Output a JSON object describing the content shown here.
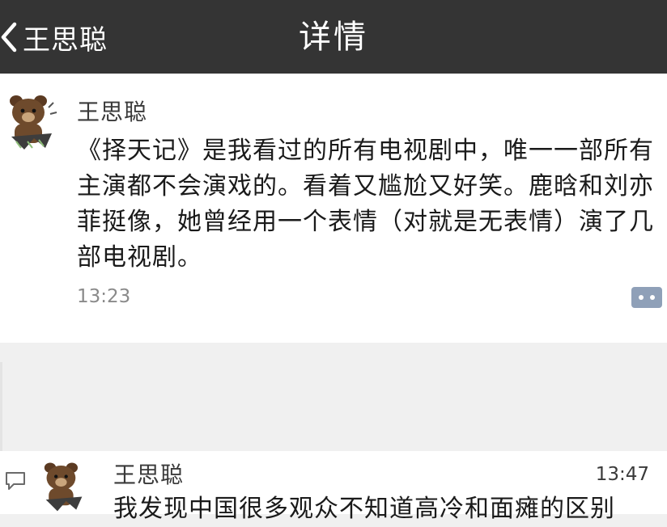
{
  "navbar": {
    "back_label": "王思聪",
    "title": "详情",
    "background": "#343434"
  },
  "post": {
    "author": "王思聪",
    "content": "《择天记》是我看过的所有电视剧中，唯一一部所有主演都不会演戏的。看着又尴尬又好笑。鹿晗和刘亦菲挺像，她曾经用一个表情（对就是无表情）演了几部电视剧。",
    "time": "13:23",
    "avatar_icon": "bear-avatar-icon",
    "more_icon": "more-dots-icon"
  },
  "comment": {
    "author": "王思聪",
    "time": "13:47",
    "content": "我发现中国很多观众不知道高冷和面瘫的区别",
    "icon": "comment-bubble-icon",
    "avatar_icon": "bear-avatar-icon"
  }
}
